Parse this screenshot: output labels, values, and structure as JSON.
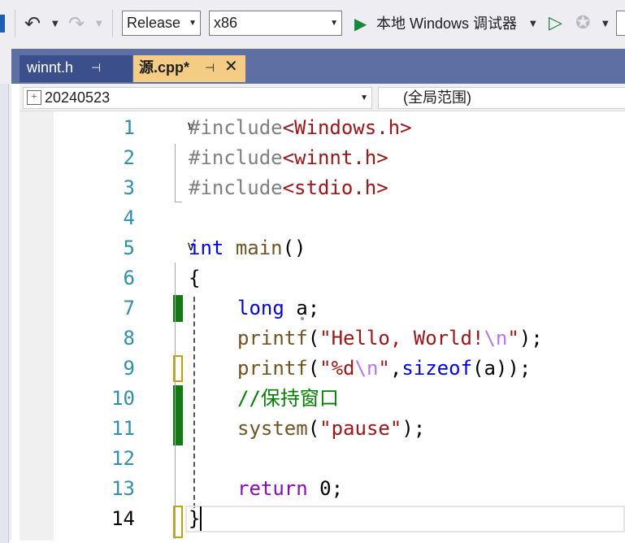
{
  "toolbar": {
    "configuration": "Release",
    "platform": "x86",
    "debugger_label": "本地 Windows 调试器",
    "icons": [
      "undo-icon",
      "redo-icon",
      "start-debug-icon",
      "start-without-debug-icon",
      "hot-reload-icon"
    ]
  },
  "tabs": [
    {
      "label": "winnt.h",
      "active": false
    },
    {
      "label": "源.cpp*",
      "active": true
    }
  ],
  "navbar": {
    "project": "20240523",
    "scope": "(全局范围)"
  },
  "editor": {
    "line_numbers": [
      "1",
      "2",
      "3",
      "4",
      "5",
      "6",
      "7",
      "8",
      "9",
      "10",
      "11",
      "12",
      "13",
      "14"
    ],
    "current_line": 14,
    "lines": {
      "l1_pp": "#include",
      "l1_lt": "<",
      "l1_file": "Windows.h",
      "l1_gt": ">",
      "l2_pp": "#include",
      "l2_lt": "<",
      "l2_file": "winnt.h",
      "l2_gt": ">",
      "l3_pp": "#include",
      "l3_lt": "<",
      "l3_file": "stdio.h",
      "l3_gt": ">",
      "l5_kw": "int",
      "l5_fn": "main",
      "l5_rest": "()",
      "l6": "{",
      "l7_kw": "long",
      "l7_rest": " a;",
      "l8_fn": "printf",
      "l8_open": "(",
      "l8_str": "\"Hello, World!",
      "l8_esc": "\\n",
      "l8_strend": "\"",
      "l8_close": ");",
      "l9_fn": "printf",
      "l9_open": "(",
      "l9_str": "\"%d",
      "l9_esc": "\\n",
      "l9_strend": "\"",
      "l9_comma": ",",
      "l9_kw": "sizeof",
      "l9_close": "(a));",
      "l10_comment": "//保持窗口",
      "l11_fn": "system",
      "l11_open": "(",
      "l11_str": "\"pause\"",
      "l11_close": ");",
      "l13_kw": "return",
      "l13_rest": " 0;",
      "l14": "}"
    },
    "change_marks": {
      "saved_lines": [
        7,
        10,
        11
      ],
      "unsaved_lines": [
        9,
        14
      ]
    },
    "colors": {
      "keyword": "#0000ff",
      "string": "#a31515",
      "comment": "#008000",
      "escape": "#b776fb",
      "line_number": "#2b91af",
      "active_tab": "#f5cc84",
      "tab_strip": "#5e6fa3"
    }
  }
}
